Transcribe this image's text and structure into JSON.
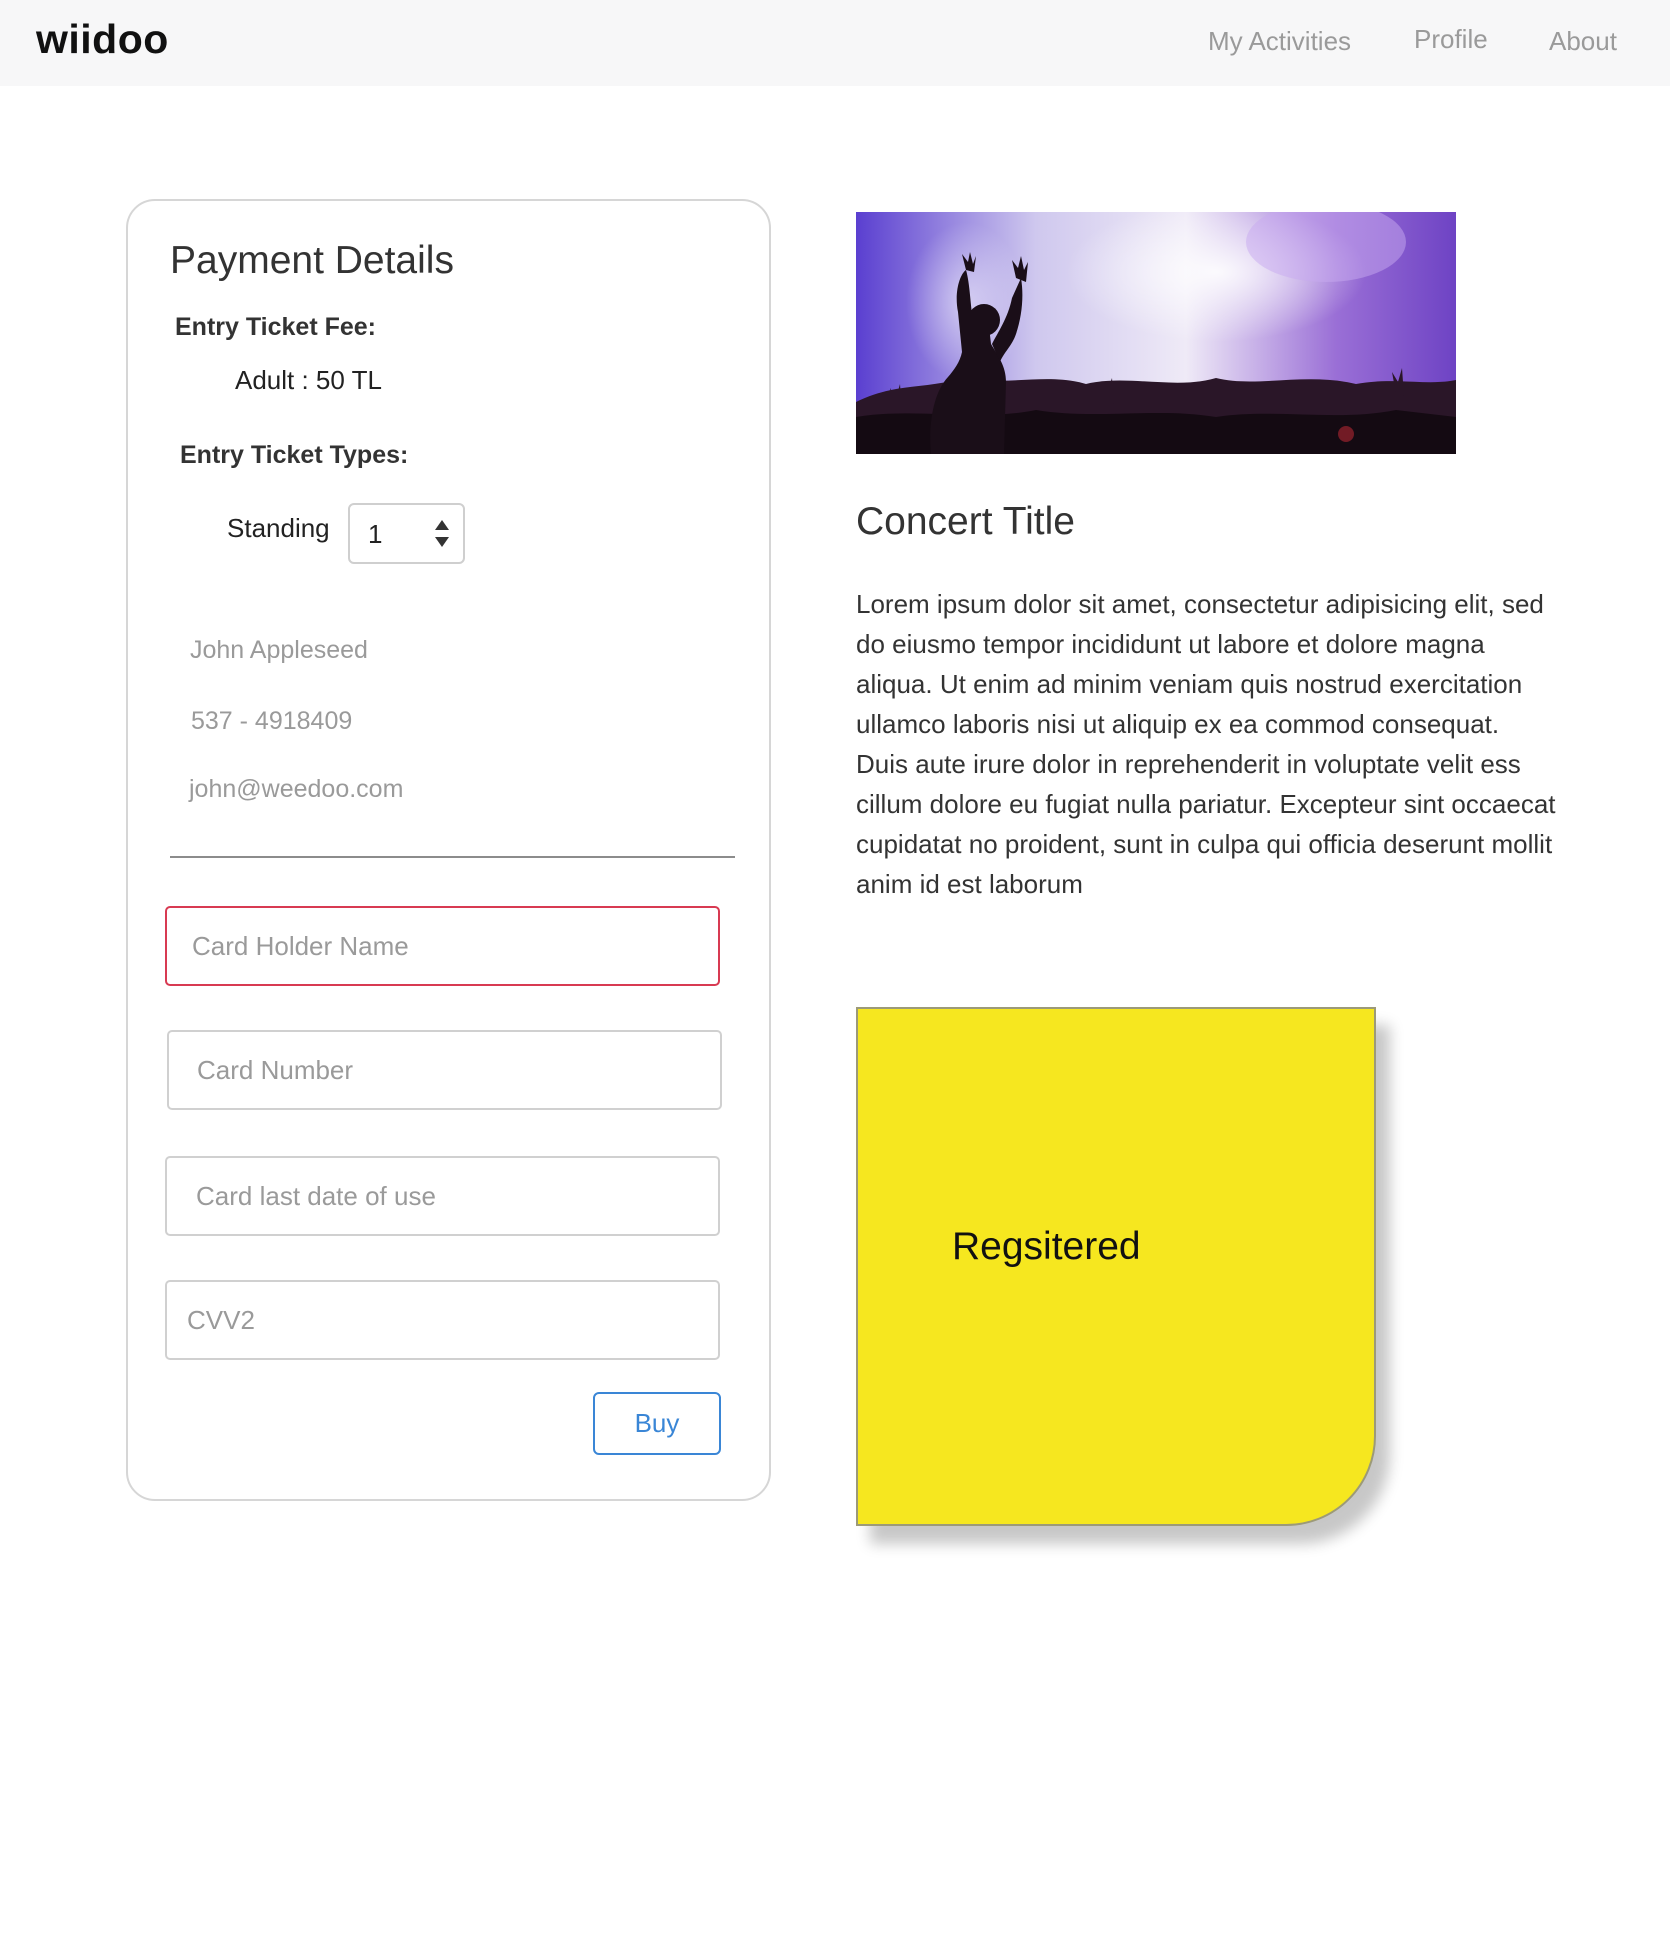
{
  "nav": {
    "brand": "wiidoo",
    "links": [
      "My Activities",
      "Profile",
      "About"
    ]
  },
  "payment": {
    "title": "Payment Details",
    "fee_label": "Entry Ticket Fee:",
    "fee_value": "Adult : 50 TL",
    "types_label": "Entry Ticket Types:",
    "standing_label": "Standing",
    "quantity": "1",
    "user": {
      "name": "John Appleseed",
      "phone": "537 - 4918409",
      "email": "john@weedoo.com"
    },
    "fields": {
      "card_holder_placeholder": "Card Holder Name",
      "card_number_placeholder": "Card Number",
      "card_date_placeholder": "Card last date of use",
      "cvv_placeholder": "CVV2"
    },
    "buy_label": "Buy"
  },
  "concert": {
    "title": "Concert Title",
    "description": "Lorem ipsum dolor sit amet, consectetur adipisicing elit, sed do eiusmo tempor incididunt ut labore et dolore magna aliqua. Ut enim ad minim veniam quis nostrud exercitation ullamco laboris nisi ut aliquip ex ea commod consequat. Duis aute irure dolor in reprehenderit in voluptate velit ess cillum dolore eu fugiat nulla pariatur. Excepteur sint occaecat cupidatat no proident, sunt in culpa qui officia deserunt mollit anim id est laborum"
  },
  "status_note": {
    "text": "Regsitered",
    "color": "#f6e71f"
  },
  "colors": {
    "accent": "#3a86d6",
    "error_border": "#d83a52",
    "nav_bg": "#f7f7f8"
  }
}
